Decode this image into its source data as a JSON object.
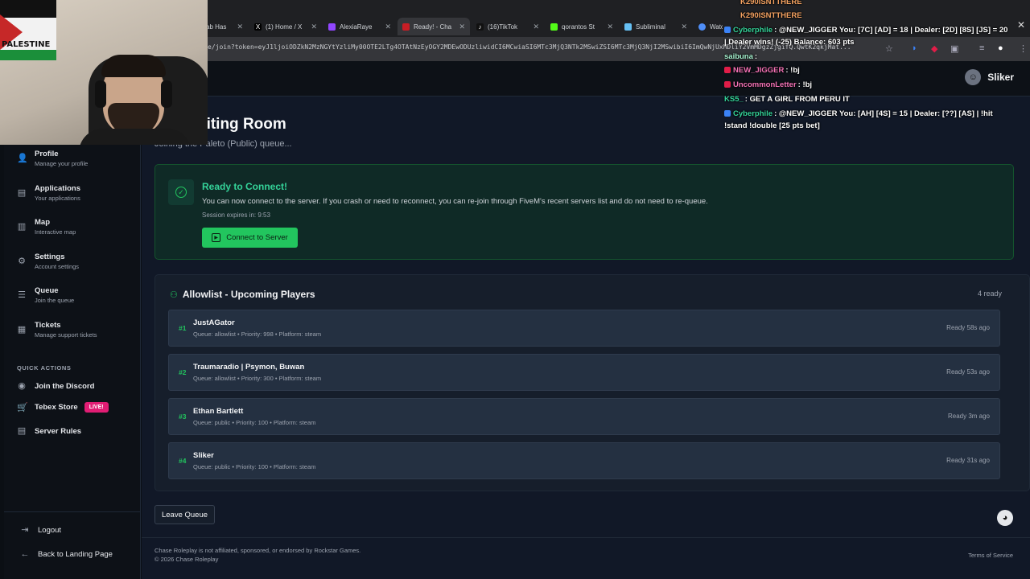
{
  "browser": {
    "tabs": [
      {
        "label": "ab Has",
        "active": false,
        "color": "#888888"
      },
      {
        "label": "(1) Home / X",
        "active": false,
        "color": "#ffffff"
      },
      {
        "label": "AlexiaRaye",
        "active": false,
        "color": "#9146ff"
      },
      {
        "label": "Ready! - Cha",
        "active": true,
        "color": "#c81d25"
      },
      {
        "label": "(16)TikTok",
        "active": false,
        "color": "#ffffff"
      },
      {
        "label": "qorantos St",
        "active": false,
        "color": "#53fc18"
      },
      {
        "label": "Subliminal",
        "active": false,
        "color": "#66c0f4"
      },
      {
        "label": "Watch",
        "active": false,
        "color": "#4f8ef7"
      }
    ],
    "url": "e/join?token=eyJ1ljoiODZkN2MzNGYtYzliMy00OTE2LTg4OTAtNzEyOGY2MDEwODUzliwidCI6MCwiaSI6MTc3MjQ3NTk2MSwiZSI6MTc3MjQ3NjI2MSwibiI6ImQwNjUxMDliY2VmMDgzZjgifQ.QwtK2qkjMat..."
  },
  "header": {
    "username": "Sliker",
    "avatar_icon": "user-avatar"
  },
  "sidebar": {
    "items": [
      {
        "title": "Profile",
        "sub": "Manage your profile",
        "icon": "user-icon"
      },
      {
        "title": "Applications",
        "sub": "Your applications",
        "icon": "document-icon"
      },
      {
        "title": "Map",
        "sub": "Interactive map",
        "icon": "map-icon"
      },
      {
        "title": "Settings",
        "sub": "Account settings",
        "icon": "gear-icon"
      },
      {
        "title": "Queue",
        "sub": "Join the queue",
        "icon": "list-icon"
      },
      {
        "title": "Tickets",
        "sub": "Manage support tickets",
        "icon": "ticket-icon"
      }
    ],
    "quick_actions_label": "QUICK ACTIONS",
    "quick_actions": [
      {
        "label": "Join the Discord",
        "icon": "discord-icon"
      },
      {
        "label": "Tebex Store",
        "icon": "cart-icon",
        "badge": "LIVE!"
      },
      {
        "label": "Server Rules",
        "icon": "rules-icon"
      }
    ],
    "logout": "Logout",
    "back": "Back to Landing Page"
  },
  "main": {
    "title": "aiting Room",
    "subtitle": "Joining the Paleto (Public) queue...",
    "ready": {
      "title": "Ready to Connect!",
      "desc": "You can now connect to the server. If you crash or need to reconnect, you can re-join through FiveM's recent servers list and do not need to re-queue.",
      "expires": "Session expires in: 9:53",
      "connect_label": "Connect to Server"
    },
    "allowlist": {
      "title": "Allowlist - Upcoming Players",
      "count": "4 ready",
      "rows": [
        {
          "num": "#1",
          "name": "JustAGator",
          "meta": "Queue: allowlist • Priority: 998 • Platform: steam",
          "ago": "Ready 58s ago"
        },
        {
          "num": "#2",
          "name": "Traumaradio | Psymon, Buwan",
          "meta": "Queue: allowlist • Priority: 300 • Platform: steam",
          "ago": "Ready 53s ago"
        },
        {
          "num": "#3",
          "name": "Ethan Bartlett",
          "meta": "Queue: public • Priority: 100 • Platform: steam",
          "ago": "Ready 3m ago"
        },
        {
          "num": "#4",
          "name": "Sliker",
          "meta": "Queue: public • Priority: 100 • Platform: steam",
          "ago": "Ready 31s ago"
        }
      ]
    },
    "leave_label": "Leave Queue",
    "footer": {
      "line1": "Chase Roleplay is not affiliated, sponsored, or endorsed by Rockstar Games.",
      "line2": "© 2026 Chase Roleplay",
      "terms": "Terms of Service"
    }
  },
  "webcam": {
    "flag_text": "PALESTINE"
  },
  "chat": [
    {
      "user": "K290ISNTTHERE",
      "text": "",
      "color": "#f4a261"
    },
    {
      "user": "K290ISNTTHERE",
      "text": "",
      "color": "#f4a261"
    },
    {
      "user": "Cyberphile",
      "text": ": @NEW_JIGGER You: [7C] [AD] = 18 | Dealer: [2D] [8S] [JS] = 20",
      "color": "#34d399"
    },
    {
      "user": "",
      "text": "| Dealer wins! (-25) Balance: 603 pts",
      "color": "#ffffff"
    },
    {
      "user": "saibuna",
      "text": ":",
      "color": "#a7f3d0"
    },
    {
      "user": "NEW_JIGGER",
      "text": ": !bj",
      "color": "#f472b6"
    },
    {
      "user": "UncommonLetter",
      "text": ": !bj",
      "color": "#f472b6"
    },
    {
      "user": "KS5_",
      "text": ": GET A GIRL FROM PERU IT",
      "color": "#34d399"
    },
    {
      "user": "Cyberphile",
      "text": ": @NEW_JIGGER You: [AH] [4S] = 15 | Dealer: [??] [AS] | !hit",
      "color": "#34d399"
    },
    {
      "user": "",
      "text": "!stand !double [25 pts bet]",
      "color": "#ffffff"
    }
  ]
}
